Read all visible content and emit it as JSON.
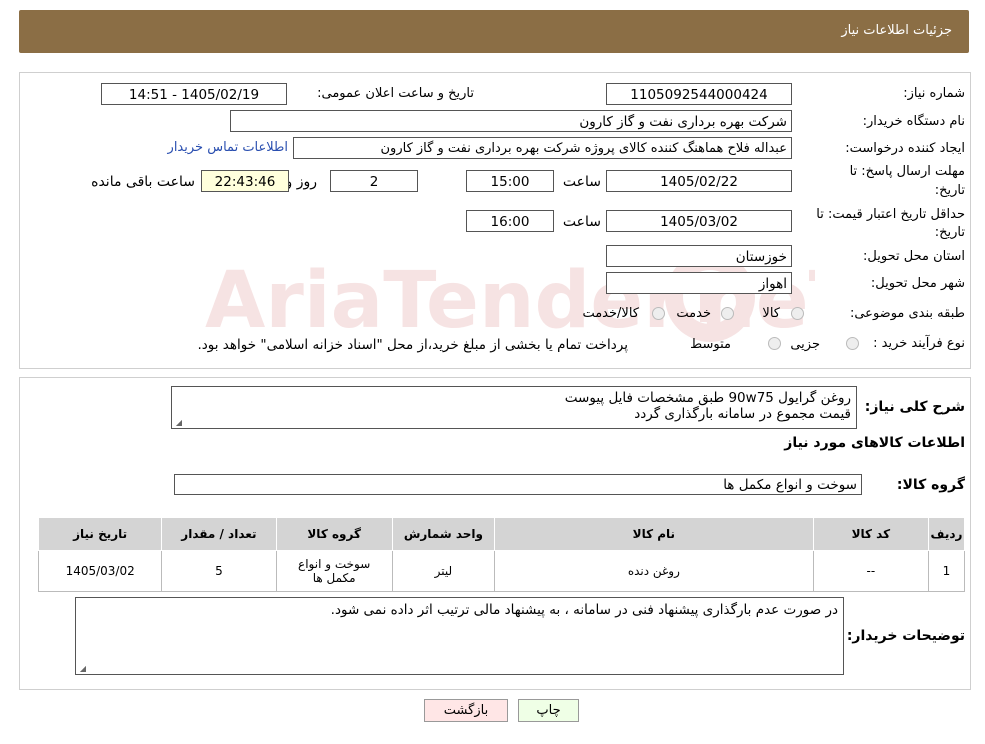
{
  "header": {
    "title": "جزئیات اطلاعات نیاز"
  },
  "fields": {
    "need_number_label": "شماره نیاز:",
    "need_number": "1105092544000424",
    "announce_label": "تاریخ و ساعت اعلان عمومی:",
    "announce_value": "1405/02/19 - 14:51",
    "buyer_org_label": "نام دستگاه خریدار:",
    "buyer_org": "شرکت بهره برداری نفت و گاز کارون",
    "requester_label": "ایجاد کننده درخواست:",
    "requester": "عبداله فلاح هماهنگ کننده کالای پروژه شرکت بهره برداری نفت و گاز کارون",
    "contact_link": "اطلاعات تماس خریدار",
    "deadline_label_1": "مهلت ارسال پاسخ: تا",
    "deadline_label_2": "تاریخ:",
    "deadline_date": "1405/02/22",
    "time_label": "ساعت",
    "deadline_time": "15:00",
    "days_value": "2",
    "days_label": "روز و",
    "remaining_time": "22:43:46",
    "remaining_label": "ساعت باقی مانده",
    "validity_label_1": "حداقل تاریخ اعتبار قیمت: تا",
    "validity_label_2": "تاریخ:",
    "validity_date": "1405/03/02",
    "validity_time_label": "ساعت",
    "validity_time": "16:00",
    "province_label": "استان محل تحویل:",
    "province": "خوزستان",
    "city_label": "شهر محل تحویل:",
    "city": "اهواز",
    "category_label": "طبقه بندی موضوعی:",
    "category_options": [
      "کالا",
      "خدمت",
      "کالا/خدمت"
    ],
    "process_label": "نوع فرآیند خرید :",
    "process_options": [
      "جزیی",
      "متوسط"
    ],
    "process_note": "پرداخت تمام یا بخشی از مبلغ خرید،از محل \"اسناد خزانه اسلامی\" خواهد بود."
  },
  "watermark": {
    "text": "AriaTender.neT"
  },
  "description": {
    "label": "شرح کلی نیاز:",
    "line1": "روغن گرایول 90w75 طبق مشخصات فایل پیوست",
    "line2": "قیمت مجموع در سامانه بارگذاری گردد"
  },
  "goods": {
    "section_title": "اطلاعات کالاهای مورد نیاز",
    "group_label": "گروه کالا:",
    "group_value": "سوخت و انواع مکمل ها",
    "columns": [
      "ردیف",
      "کد کالا",
      "نام کالا",
      "واحد شمارش",
      "گروه کالا",
      "تعداد / مقدار",
      "تاریخ نیاز"
    ],
    "rows": [
      {
        "index": "1",
        "code": "--",
        "name": "روغن دنده",
        "unit": "لیتر",
        "group_line1": "سوخت و انواع",
        "group_line2": "مکمل ها",
        "qty": "5",
        "date": "1405/03/02"
      }
    ]
  },
  "buyer_notes": {
    "label": "توضیحات خریدار:",
    "text": "در صورت عدم بارگذاری پیشنهاد فنی در سامانه ، به پیشنهاد مالی ترتیب اثر داده نمی شود."
  },
  "buttons": {
    "print": "چاپ",
    "back": "بازگشت"
  }
}
